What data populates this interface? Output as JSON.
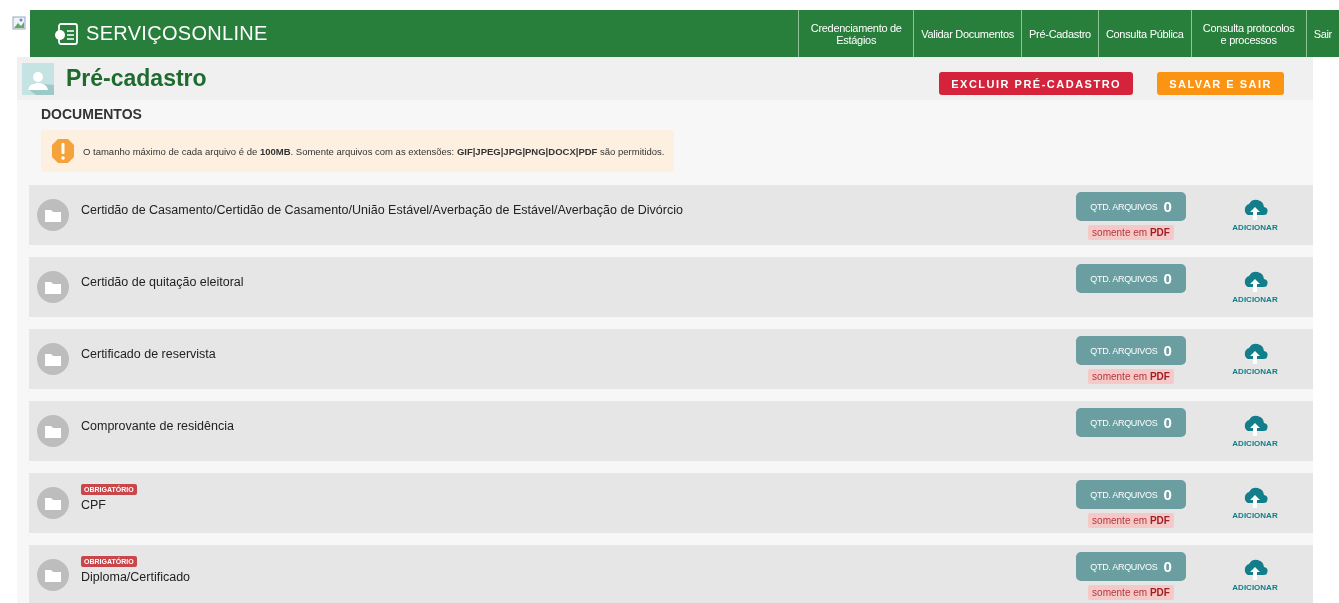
{
  "header": {
    "brand": "SERVIÇOSONLINE",
    "nav": [
      {
        "label": "Credenciamento de Estágios"
      },
      {
        "label": "Validar Documentos"
      },
      {
        "label": "Pré-Cadastro"
      },
      {
        "label": "Consulta Pública"
      },
      {
        "label": "Consulta protocolos e processos"
      },
      {
        "label": "Sair"
      }
    ]
  },
  "page": {
    "title": "Pré-cadastro",
    "buttons": [
      {
        "label": "EXCLUIR PRÉ-CADASTRO",
        "kind": "danger"
      },
      {
        "label": "SALVAR E SAIR",
        "kind": "warning"
      }
    ]
  },
  "section": {
    "title": "DOCUMENTOS",
    "notice": "O tamanho máximo de cada arquivo é de **100MB**. Somente arquivos com as extensões: **GIF|JPEG|JPG|PNG|DOCX|PDF** são permitidos."
  },
  "documents": [
    {
      "name": "Certidão de Casamento/Certidão de Casamento/União Estável/Averbação de Estável/Averbação de Divórcio",
      "count_label": "QTD. ARQUIVOS",
      "count": "0",
      "note": "somente em **PDF**",
      "action": "ADICIONAR"
    },
    {
      "name": "Certidão de quitação eleitoral",
      "count_label": "QTD. ARQUIVOS",
      "count": "0",
      "action": "ADICIONAR"
    },
    {
      "name": "Certificado de reservista",
      "count_label": "QTD. ARQUIVOS",
      "count": "0",
      "note": "somente em **PDF**",
      "action": "ADICIONAR"
    },
    {
      "name": "Comprovante de residência",
      "count_label": "QTD. ARQUIVOS",
      "count": "0",
      "action": "ADICIONAR"
    },
    {
      "badge": "OBRIGATÓRIO",
      "name": "CPF",
      "count_label": "QTD. ARQUIVOS",
      "count": "0",
      "note": "somente em **PDF**",
      "action": "ADICIONAR"
    },
    {
      "badge": "OBRIGATÓRIO",
      "name": "Diploma/Certificado",
      "count_label": "QTD. ARQUIVOS",
      "count": "0",
      "note": "somente em **PDF**",
      "action": "ADICIONAR"
    }
  ]
}
